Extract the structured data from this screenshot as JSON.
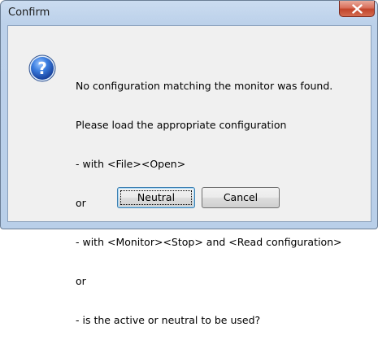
{
  "window": {
    "title": "Confirm",
    "close_icon": "close-x-icon"
  },
  "dialog": {
    "icon": "question-icon",
    "message_lines": [
      "No configuration matching the monitor was found.",
      "Please load the appropriate configuration",
      "- with <File><Open>",
      "or",
      "- with <Monitor><Stop> and <Read configuration>",
      "or",
      "- is the active or neutral to be used?"
    ],
    "buttons": {
      "neutral_label": "Neutral",
      "cancel_label": "Cancel"
    }
  },
  "colors": {
    "title_bar": "#bcd1ea",
    "content_bg": "#f0f0f0",
    "close_button": "#c2452b",
    "question_icon": "#1f5fbf"
  }
}
